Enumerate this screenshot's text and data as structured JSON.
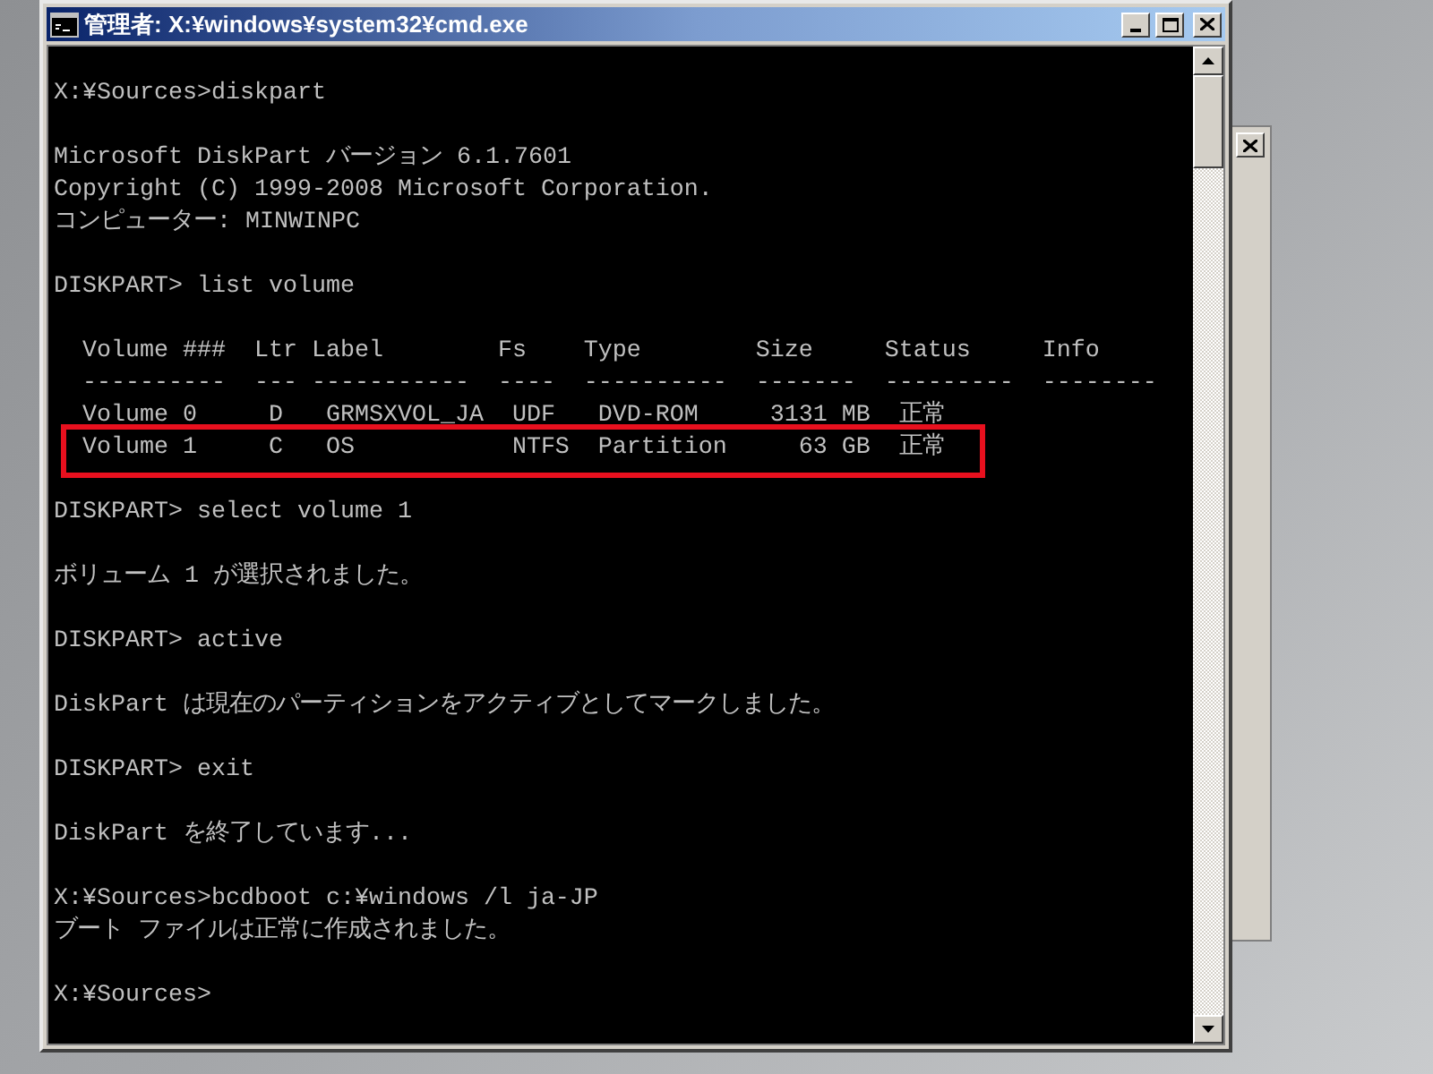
{
  "window": {
    "title": "管理者: X:¥windows¥system32¥cmd.exe"
  },
  "console": {
    "lines": [
      {
        "kind": "blank"
      },
      {
        "kind": "text",
        "text": "X:¥Sources>diskpart",
        "boxed": false
      },
      {
        "kind": "blank"
      },
      {
        "kind": "text",
        "text": "Microsoft DiskPart バージョン 6.1.7601",
        "boxed": false
      },
      {
        "kind": "text",
        "text": "Copyright (C) 1999-2008 Microsoft Corporation.",
        "boxed": false
      },
      {
        "kind": "text",
        "text": "コンピューター: MINWINPC",
        "boxed": false
      },
      {
        "kind": "blank"
      },
      {
        "kind": "text",
        "text": "DISKPART> list volume",
        "boxed": false
      },
      {
        "kind": "blank"
      },
      {
        "kind": "text",
        "text": "  Volume ###  Ltr Label        Fs    Type        Size     Status     Info",
        "boxed": false
      },
      {
        "kind": "text",
        "text": "  ----------  --- -----------  ----  ----------  -------  ---------  --------",
        "boxed": false
      },
      {
        "kind": "text",
        "text": "  Volume 0     D   GRMSXVOL_JA  UDF   DVD-ROM     3131 MB  正常",
        "boxed": false
      },
      {
        "kind": "text",
        "text": "  Volume 1     C   OS           NTFS  Partition     63 GB  正常",
        "boxed": true
      },
      {
        "kind": "blank"
      },
      {
        "kind": "text",
        "text": "DISKPART> select volume 1",
        "boxed": false
      },
      {
        "kind": "blank"
      },
      {
        "kind": "text",
        "text": "ボリューム 1 が選択されました。",
        "boxed": false
      },
      {
        "kind": "blank"
      },
      {
        "kind": "text",
        "text": "DISKPART> active",
        "boxed": false
      },
      {
        "kind": "blank"
      },
      {
        "kind": "text",
        "text": "DiskPart は現在のパーティションをアクティブとしてマークしました。",
        "boxed": false
      },
      {
        "kind": "blank"
      },
      {
        "kind": "text",
        "text": "DISKPART> exit",
        "boxed": false
      },
      {
        "kind": "blank"
      },
      {
        "kind": "text",
        "text": "DiskPart を終了しています...",
        "boxed": false
      },
      {
        "kind": "blank"
      },
      {
        "kind": "text",
        "text": "X:¥Sources>bcdboot c:¥windows /l ja-JP",
        "boxed": false
      },
      {
        "kind": "text",
        "text": "ブート ファイルは正常に作成されました。",
        "boxed": false
      },
      {
        "kind": "blank"
      },
      {
        "kind": "text",
        "text": "X:¥Sources>",
        "boxed": false
      }
    ]
  }
}
